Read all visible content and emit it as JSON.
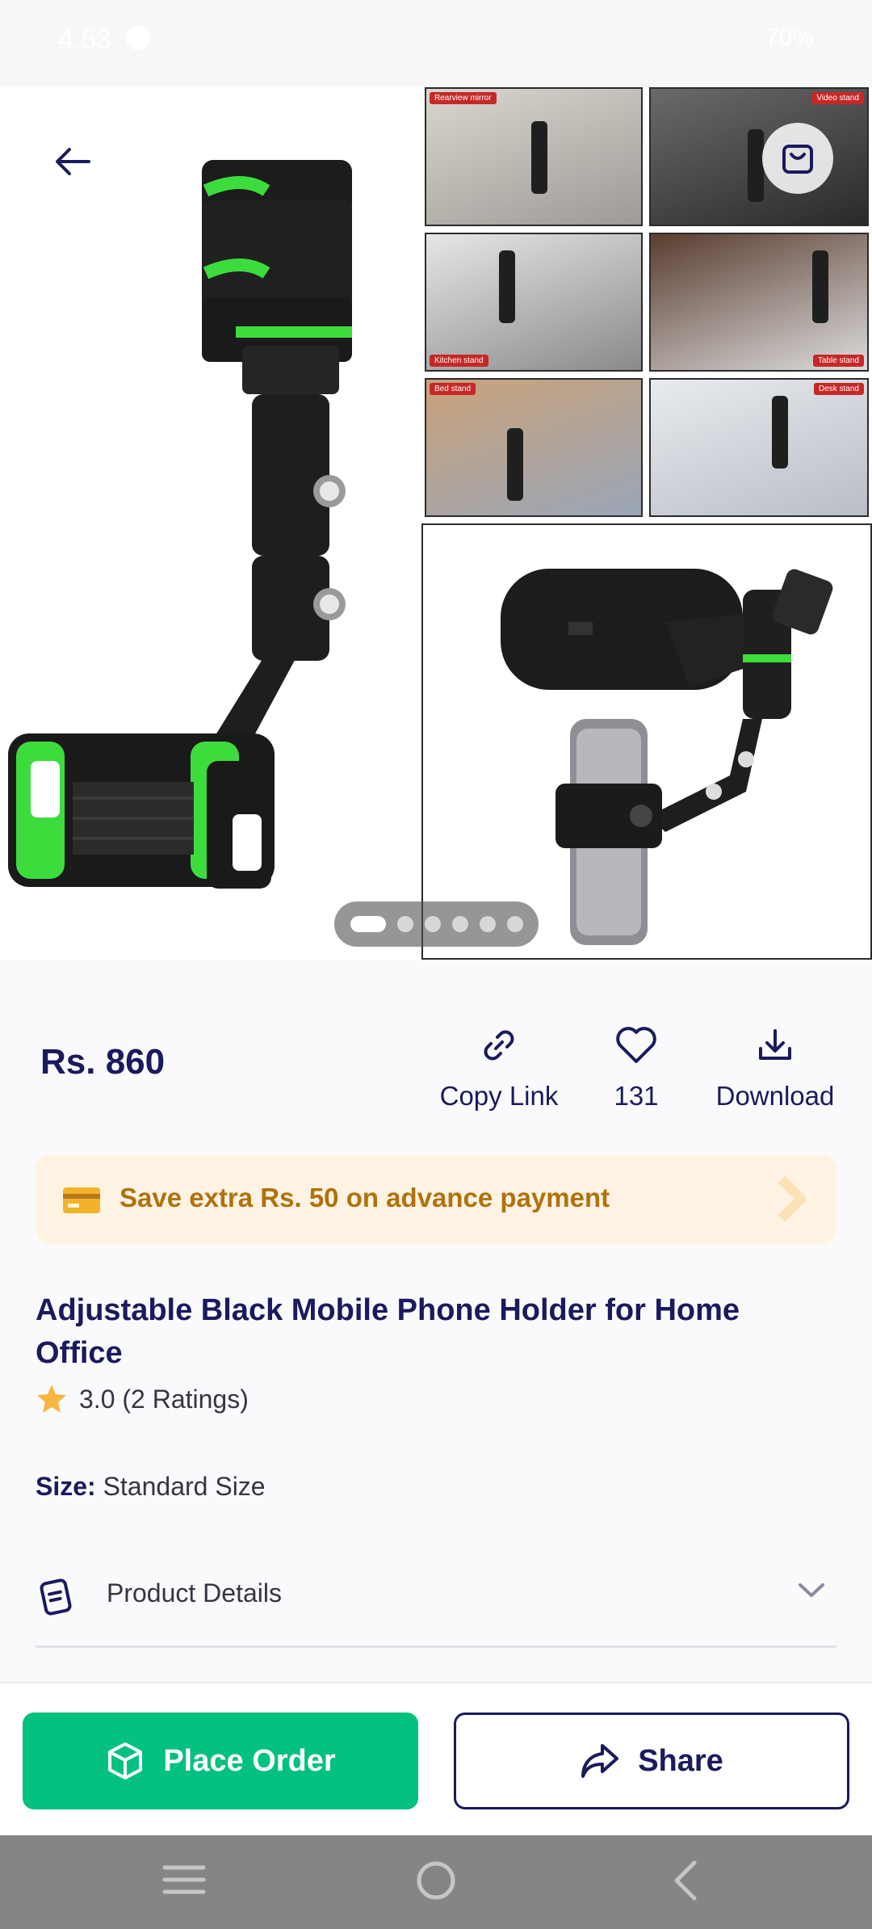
{
  "status_bar": {
    "time": "4:53",
    "battery": "70%"
  },
  "gallery": {
    "tiles": [
      {
        "tag": "Rearview mirror"
      },
      {
        "tag": "Video stand"
      },
      {
        "tag": "Kitchen stand"
      },
      {
        "tag": "Table stand"
      },
      {
        "tag": "Bed stand"
      },
      {
        "tag": "Desk stand"
      }
    ],
    "slide_count": 6,
    "active_slide": 1
  },
  "product": {
    "price": "Rs. 860",
    "title": "Adjustable Black Mobile Phone Holder for Home Office",
    "rating_text": "3.0 (2 Ratings)",
    "size_label": "Size:",
    "size_value": "Standard Size"
  },
  "actions": {
    "copy_link": "Copy Link",
    "likes": "131",
    "download": "Download"
  },
  "offer": {
    "text": "Save extra Rs. 50 on advance payment"
  },
  "details": {
    "label": "Product Details"
  },
  "buttons": {
    "place_order": "Place Order",
    "share": "Share"
  },
  "colors": {
    "brand": "#1a1a5e",
    "order_green": "#03c17e",
    "offer_bg": "#fef3e3",
    "offer_text": "#b0720d",
    "star": "#f7b543"
  }
}
